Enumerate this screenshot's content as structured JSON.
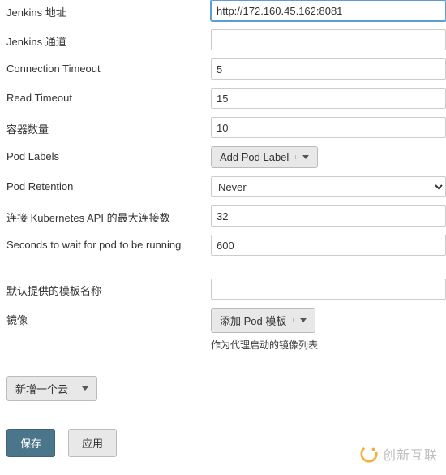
{
  "fields": {
    "jenkins_url": {
      "label": "Jenkins 地址",
      "value": "http://172.160.45.162:8081"
    },
    "jenkins_tunnel": {
      "label": "Jenkins 通道",
      "value": ""
    },
    "connection_timeout": {
      "label": "Connection Timeout",
      "value": "5"
    },
    "read_timeout": {
      "label": "Read Timeout",
      "value": "15"
    },
    "container_cap": {
      "label": "容器数量",
      "value": "10"
    },
    "pod_labels": {
      "label": "Pod Labels",
      "button": "Add Pod Label"
    },
    "pod_retention": {
      "label": "Pod Retention",
      "value": "Never"
    },
    "max_requests": {
      "label": "连接 Kubernetes API 的最大连接数",
      "value": "32"
    },
    "wait_seconds": {
      "label": "Seconds to wait for pod to be running",
      "value": "600"
    },
    "default_template": {
      "label": "默认提供的模板名称",
      "value": ""
    },
    "images": {
      "label": "镜像",
      "button": "添加 Pod 模板",
      "helper": "作为代理启动的镜像列表"
    }
  },
  "actions": {
    "add_cloud": "新增一个云",
    "save": "保存",
    "apply": "应用"
  },
  "watermark": {
    "text": "创新互联"
  }
}
